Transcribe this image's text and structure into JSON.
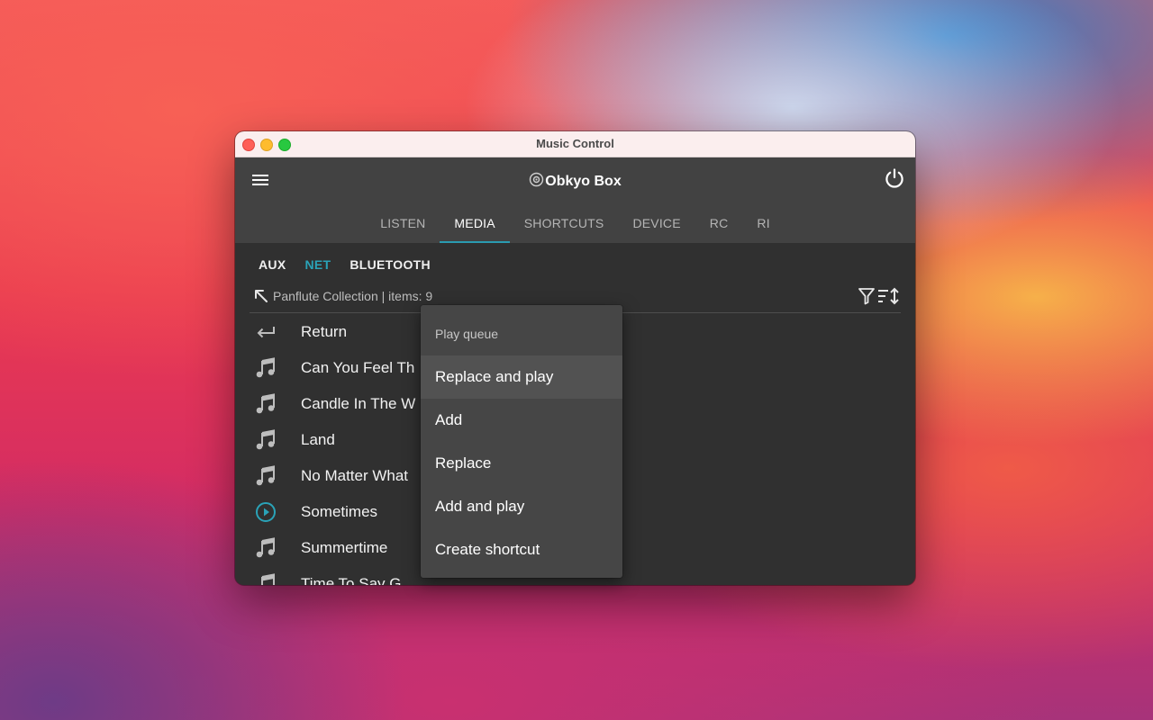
{
  "window": {
    "title": "Music Control"
  },
  "appbar": {
    "device_name": "Obkyo Box",
    "tabs": [
      {
        "label": "LISTEN",
        "active": false
      },
      {
        "label": "MEDIA",
        "active": true
      },
      {
        "label": "SHORTCUTS",
        "active": false
      },
      {
        "label": "DEVICE",
        "active": false
      },
      {
        "label": "RC",
        "active": false
      },
      {
        "label": "RI",
        "active": false
      }
    ]
  },
  "sources": [
    {
      "label": "AUX",
      "active": false
    },
    {
      "label": "NET",
      "active": true
    },
    {
      "label": "BLUETOOTH",
      "active": false
    }
  ],
  "path": {
    "text": "Panflute Collection | items: 9"
  },
  "list": [
    {
      "icon": "return-icon",
      "label": "Return"
    },
    {
      "icon": "music-note-icon",
      "label": "Can You Feel Th"
    },
    {
      "icon": "music-note-icon",
      "label": "Candle In The W"
    },
    {
      "icon": "music-note-icon",
      "label": "Land"
    },
    {
      "icon": "music-note-icon",
      "label": "No Matter What"
    },
    {
      "icon": "play-circle-icon",
      "label": "Sometimes"
    },
    {
      "icon": "music-note-icon",
      "label": "Summertime"
    },
    {
      "icon": "music-note-icon",
      "label": "Time To Say G"
    }
  ],
  "popup": {
    "title": "Play queue",
    "items": [
      {
        "label": "Replace and play"
      },
      {
        "label": "Add"
      },
      {
        "label": "Replace"
      },
      {
        "label": "Add and play"
      },
      {
        "label": "Create shortcut"
      }
    ]
  },
  "colors": {
    "accent": "#2aa3b8",
    "tab_indicator": "#2a9bb1",
    "appbar": "#424242",
    "content": "#303030",
    "popup": "#464646"
  }
}
